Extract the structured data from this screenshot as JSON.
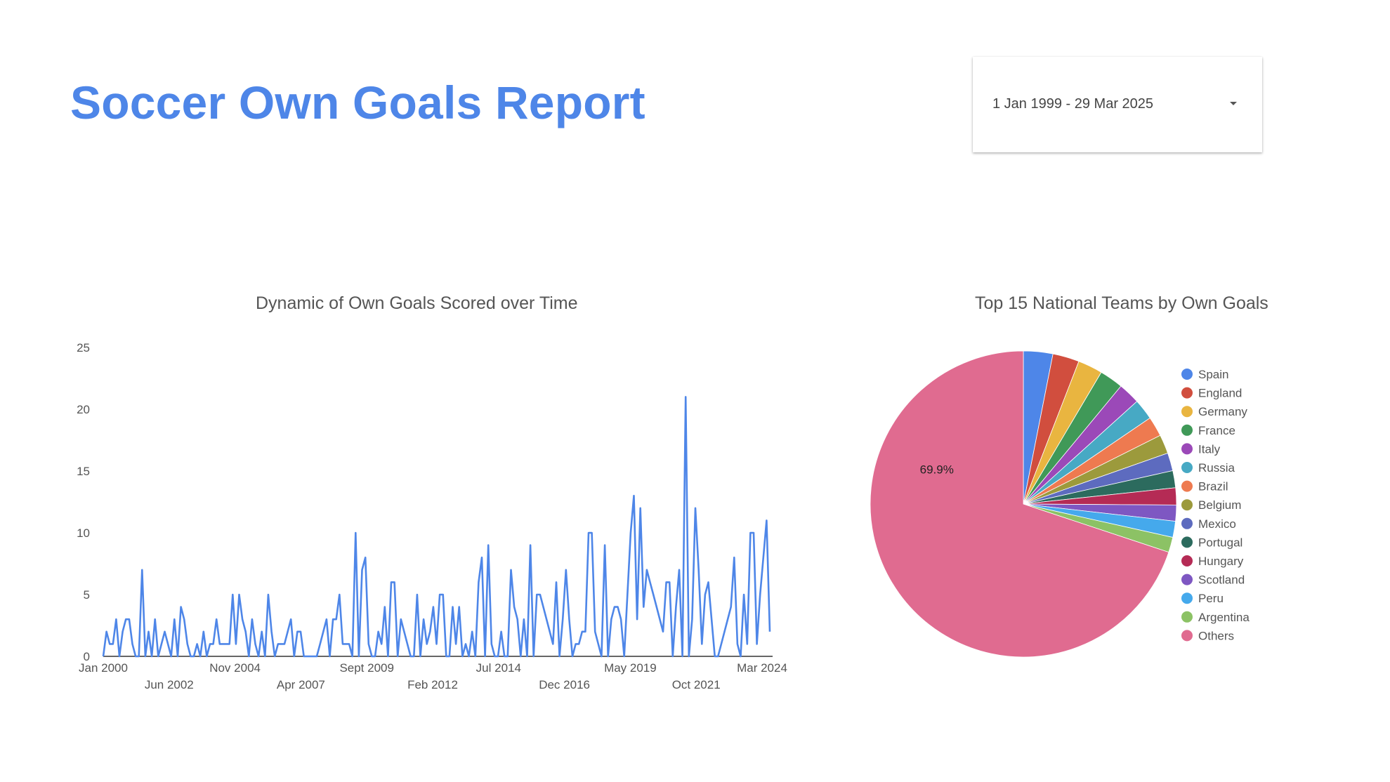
{
  "header": {
    "title": "Soccer Own Goals Report",
    "date_range": "1 Jan 1999 - 29 Mar 2025"
  },
  "icons": {
    "date_dropdown": "chevron-down-icon"
  },
  "colors": {
    "title": "#4e86e8",
    "line": "#4e86e8"
  },
  "chart_data": [
    {
      "type": "line",
      "title": "Dynamic of Own Goals Scored over Time",
      "xlabel": "",
      "ylabel": "",
      "ylim": [
        0,
        25
      ],
      "yticks": [
        0,
        5,
        10,
        15,
        20,
        25
      ],
      "xticks": [
        "Jan 2000",
        "Jun 2002",
        "Nov 2004",
        "Apr 2007",
        "Sept 2009",
        "Feb 2012",
        "Jul 2014",
        "Dec 2016",
        "May 2019",
        "Oct 2021",
        "Mar 2024"
      ],
      "grid": false,
      "series": [
        {
          "color": "#4e86e8",
          "values": [
            0,
            2,
            1,
            1,
            3,
            0,
            2,
            3,
            3,
            1,
            0,
            0,
            7,
            0,
            2,
            0,
            3,
            0,
            1,
            2,
            1,
            0,
            3,
            0,
            4,
            3,
            1,
            0,
            0,
            1,
            0,
            2,
            0,
            1,
            1,
            3,
            1,
            1,
            1,
            1,
            5,
            1,
            5,
            3,
            2,
            0,
            3,
            1,
            0,
            2,
            0,
            5,
            2,
            0,
            1,
            1,
            1,
            2,
            3,
            0,
            2,
            2,
            0,
            0,
            0,
            0,
            0,
            1,
            2,
            3,
            0,
            3,
            3,
            5,
            1,
            1,
            1,
            0,
            10,
            0,
            7,
            8,
            1,
            0,
            0,
            2,
            1,
            4,
            0,
            6,
            6,
            0,
            3,
            2,
            1,
            0,
            0,
            5,
            0,
            3,
            1,
            2,
            4,
            1,
            5,
            5,
            0,
            0,
            4,
            1,
            4,
            0,
            1,
            0,
            2,
            0,
            6,
            8,
            0,
            9,
            1,
            0,
            0,
            2,
            0,
            0,
            7,
            4,
            3,
            0,
            3,
            0,
            9,
            0,
            5,
            5,
            4,
            3,
            2,
            1,
            6,
            0,
            3,
            7,
            3,
            0,
            1,
            1,
            2,
            2,
            10,
            10,
            2,
            1,
            0,
            9,
            0,
            3,
            4,
            4,
            3,
            0,
            5,
            10,
            13,
            3,
            12,
            4,
            7,
            6,
            5,
            4,
            3,
            2,
            6,
            6,
            0,
            4,
            7,
            0,
            21,
            0,
            3,
            12,
            7,
            1,
            5,
            6,
            3,
            0,
            0,
            1,
            2,
            3,
            4,
            8,
            1,
            0,
            5,
            1,
            10,
            10,
            1,
            5,
            8,
            11,
            2
          ]
        }
      ]
    },
    {
      "type": "pie",
      "title": "Top 15 National Teams by Own Goals",
      "legend_position": "right",
      "slices": [
        {
          "label": "Spain",
          "value": 3.1,
          "color": "#4e86e8"
        },
        {
          "label": "England",
          "value": 2.8,
          "color": "#d14e3e"
        },
        {
          "label": "Germany",
          "value": 2.6,
          "color": "#e9b540"
        },
        {
          "label": "France",
          "value": 2.5,
          "color": "#409958"
        },
        {
          "label": "Italy",
          "value": 2.3,
          "color": "#9b49b8"
        },
        {
          "label": "Russia",
          "value": 2.2,
          "color": "#47a9c4"
        },
        {
          "label": "Brazil",
          "value": 2.1,
          "color": "#ee7a50"
        },
        {
          "label": "Belgium",
          "value": 2.0,
          "color": "#9c9a3c"
        },
        {
          "label": "Mexico",
          "value": 1.9,
          "color": "#5d6bbf"
        },
        {
          "label": "Portugal",
          "value": 1.8,
          "color": "#2c6b5e"
        },
        {
          "label": "Hungary",
          "value": 1.8,
          "color": "#b52b55"
        },
        {
          "label": "Scotland",
          "value": 1.7,
          "color": "#7e57c2"
        },
        {
          "label": "Peru",
          "value": 1.7,
          "color": "#45a9ec"
        },
        {
          "label": "Argentina",
          "value": 1.6,
          "color": "#8cc265"
        },
        {
          "label": "Others",
          "value": 69.9,
          "color": "#e06b90",
          "label_text": "69.9%"
        }
      ]
    }
  ]
}
